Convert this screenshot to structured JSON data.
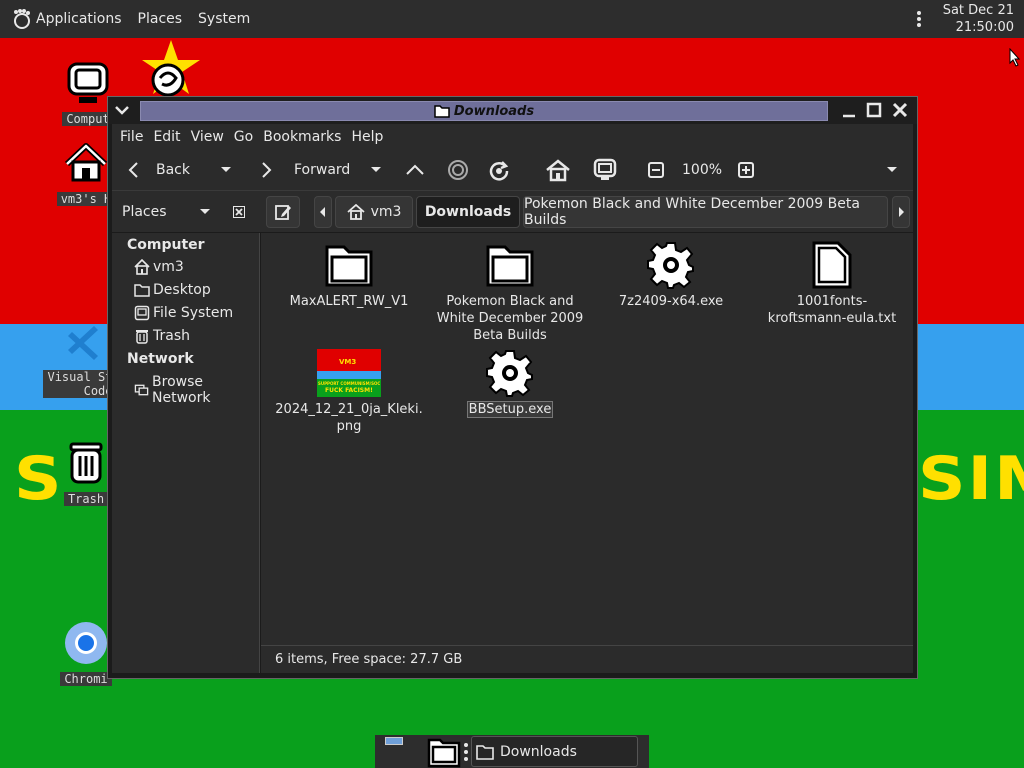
{
  "top_panel": {
    "applications": "Applications",
    "places": "Places",
    "system": "System",
    "clock_date": "Sat Dec 21",
    "clock_time": "21:50:00"
  },
  "wallpaper": {
    "left_text": "S",
    "right_text": "SIM",
    "colors": {
      "red": "#e00000",
      "blue": "#36a0ee",
      "green": "#09a01c",
      "yellow": "#ffe000"
    }
  },
  "desktop_icons": [
    {
      "label": "Comput",
      "icon": "computer-icon"
    },
    {
      "label": "vm3's H",
      "icon": "home-icon"
    },
    {
      "label": "Visual St",
      "label2": "Code",
      "icon": "vscode-icon"
    },
    {
      "label": "Trash",
      "icon": "trash-icon"
    },
    {
      "label": "Chromi",
      "icon": "chromium-icon"
    }
  ],
  "window": {
    "title": "Downloads",
    "menu": [
      "File",
      "Edit",
      "View",
      "Go",
      "Bookmarks",
      "Help"
    ],
    "toolbar": {
      "back": "Back",
      "forward": "Forward",
      "zoom": "100%"
    },
    "places_label": "Places",
    "breadcrumbs": [
      "vm3",
      "Downloads",
      "Pokemon Black and White December 2009 Beta Builds"
    ],
    "sidebar": {
      "computer_header": "Computer",
      "computer_items": [
        "vm3",
        "Desktop",
        "File System",
        "Trash"
      ],
      "network_header": "Network",
      "network_items": [
        "Browse Network"
      ]
    },
    "files": [
      {
        "name": "MaxALERT_RW_V1",
        "icon": "folder-icon"
      },
      {
        "name": "Pokemon Black and White December 2009 Beta Builds",
        "name_lines": [
          "Pokemon Black and",
          "White December 2009",
          "Beta Builds"
        ],
        "icon": "folder-icon"
      },
      {
        "name": "7z2409-x64.exe",
        "icon": "gear-icon"
      },
      {
        "name": "1001fonts-kroftsmann-eula.txt",
        "name_lines": [
          "1001fonts-",
          "kroftsmann-eula.txt"
        ],
        "icon": "document-icon"
      },
      {
        "name": "2024_12_21_0ja_Kleki.png",
        "name_lines": [
          "2024_12_21_0ja_Kleki.",
          "png"
        ],
        "icon": "image-thumbnail",
        "thumb_text": [
          "VM3",
          "SUPPORT COMMUNISM/SOCIALISM",
          "FUCK FACISM!"
        ]
      },
      {
        "name": "BBSetup.exe",
        "icon": "gear-icon",
        "selected": true
      }
    ],
    "status": "6 items, Free space: 27.7 GB"
  },
  "bottom_panel": {
    "task_label": "Downloads"
  }
}
